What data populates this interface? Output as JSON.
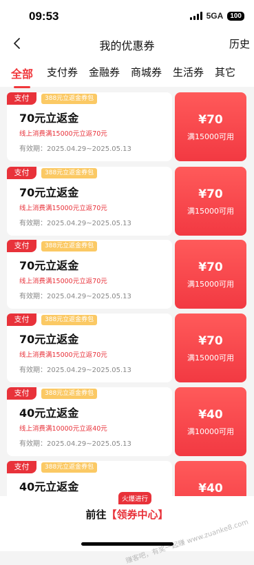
{
  "status": {
    "time": "09:53",
    "network": "5GA",
    "battery": "100"
  },
  "nav": {
    "title": "我的优惠券",
    "history": "历史"
  },
  "tabs": [
    {
      "label": "全部",
      "active": true
    },
    {
      "label": "支付券",
      "active": false
    },
    {
      "label": "金融券",
      "active": false
    },
    {
      "label": "商城券",
      "active": false
    },
    {
      "label": "生活券",
      "active": false
    },
    {
      "label": "其它",
      "active": false
    }
  ],
  "coupons": [
    {
      "tag": "支付",
      "pack": "388元立返金券包",
      "title": "70元立返金",
      "rule": "线上消费满15000元立返70元",
      "expiry": "有效期：2025.04.29~2025.05.13",
      "amount": "¥70",
      "condition": "满15000可用"
    },
    {
      "tag": "支付",
      "pack": "388元立返金券包",
      "title": "70元立返金",
      "rule": "线上消费满15000元立返70元",
      "expiry": "有效期：2025.04.29~2025.05.13",
      "amount": "¥70",
      "condition": "满15000可用"
    },
    {
      "tag": "支付",
      "pack": "388元立返金券包",
      "title": "70元立返金",
      "rule": "线上消费满15000元立返70元",
      "expiry": "有效期：2025.04.29~2025.05.13",
      "amount": "¥70",
      "condition": "满15000可用"
    },
    {
      "tag": "支付",
      "pack": "388元立返金券包",
      "title": "70元立返金",
      "rule": "线上消费满15000元立返70元",
      "expiry": "有效期：2025.04.29~2025.05.13",
      "amount": "¥70",
      "condition": "满15000可用"
    },
    {
      "tag": "支付",
      "pack": "388元立返金券包",
      "title": "40元立返金",
      "rule": "线上消费满10000元立返40元",
      "expiry": "有效期：2025.04.29~2025.05.13",
      "amount": "¥40",
      "condition": "满10000可用"
    },
    {
      "tag": "支付",
      "pack": "388元立返金券包",
      "title": "40元立返金",
      "rule": "",
      "expiry": "",
      "amount": "¥40",
      "condition": ""
    }
  ],
  "bottom": {
    "badge": "火爆进行",
    "cta_prefix": "前往",
    "cta_highlight": "【领券中心】"
  },
  "watermark": "赚客吧，有奖一起赚 www.zuanke8.com",
  "colors": {
    "accent": "#e8323a",
    "pack_tag": "#fbc964",
    "background": "#f4f4f4"
  }
}
